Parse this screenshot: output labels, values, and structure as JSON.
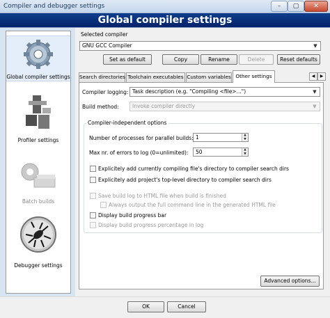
{
  "window": {
    "title": "Compiler and debugger settings",
    "buttons": {
      "minimize": "–",
      "maximize": "▢",
      "close": "✕"
    }
  },
  "banner": {
    "title": "Global compiler settings"
  },
  "sidebar": {
    "items": [
      {
        "label": "Global compiler settings",
        "icon": "gear-icon",
        "enabled": true
      },
      {
        "label": "Profiler settings",
        "icon": "profiler-icon",
        "enabled": true
      },
      {
        "label": "Batch builds",
        "icon": "batch-builds-icon",
        "enabled": false
      },
      {
        "label": "Debugger settings",
        "icon": "bug-icon",
        "enabled": true
      }
    ]
  },
  "selected_compiler": {
    "label": "Selected compiler",
    "value": "GNU GCC Compiler",
    "buttons": {
      "set_default": "Set as default",
      "copy": "Copy",
      "rename": "Rename",
      "delete": "Delete",
      "reset_defaults": "Reset defaults"
    }
  },
  "tabs": [
    {
      "label": "Search directories",
      "active": false
    },
    {
      "label": "Toolchain executables",
      "active": false
    },
    {
      "label": "Custom variables",
      "active": false
    },
    {
      "label": "Other settings",
      "active": true
    }
  ],
  "tab_arrows": {
    "left": "◀",
    "right": "▶"
  },
  "other_settings": {
    "compiler_logging": {
      "label": "Compiler logging:",
      "value": "Task description (e.g. \"Compiling <file>...\")"
    },
    "build_method": {
      "label": "Build method:",
      "value": "Invoke compiler directly"
    },
    "group_title": "Compiler-independent options",
    "parallel_processes": {
      "label": "Number of processes for parallel builds:",
      "value": "1"
    },
    "max_errors": {
      "label": "Max nr. of errors to log (0=unlimited):",
      "value": "50"
    },
    "checkboxes": [
      {
        "label": "Explicitely add currently compiling file's directory to compiler search dirs",
        "checked": false,
        "enabled": true
      },
      {
        "label": "Explicitely add project's top-level directory to compiler search dirs",
        "checked": false,
        "enabled": true
      },
      {
        "label": "Save build log to HTML file when build is finished",
        "checked": false,
        "enabled": false
      },
      {
        "label": "Always output the full command line in the generated HTML file",
        "checked": false,
        "enabled": false
      },
      {
        "label": "Display build progress bar",
        "checked": false,
        "enabled": true
      },
      {
        "label": "Display build progress percentage in log",
        "checked": false,
        "enabled": false
      }
    ],
    "advanced_button": "Advanced options..."
  },
  "dialog_buttons": {
    "ok": "OK",
    "cancel": "Cancel"
  }
}
